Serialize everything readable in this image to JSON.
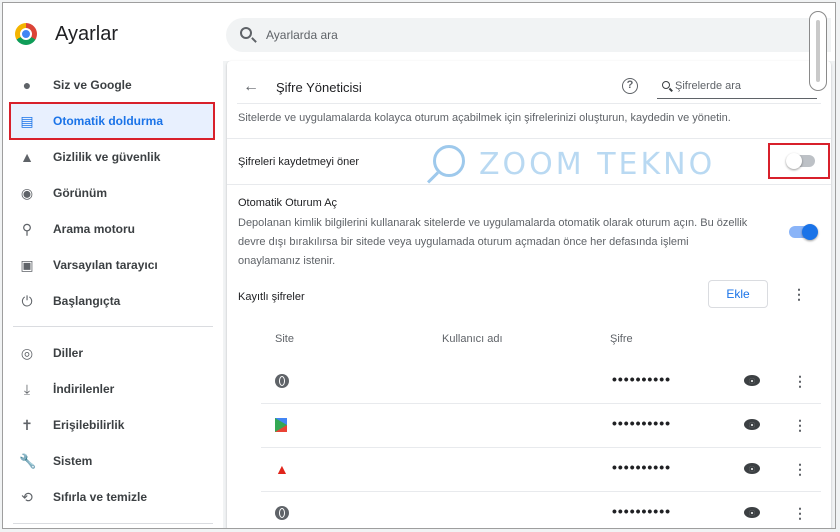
{
  "header": {
    "title": "Ayarlar",
    "search_placeholder": "Ayarlarda ara"
  },
  "sidebar": {
    "items": [
      {
        "label": "Siz ve Google",
        "icon": "person-icon"
      },
      {
        "label": "Otomatik doldurma",
        "icon": "clipboard-icon",
        "active": true
      },
      {
        "label": "Gizlilik ve güvenlik",
        "icon": "shield-icon"
      },
      {
        "label": "Görünüm",
        "icon": "palette-icon"
      },
      {
        "label": "Arama motoru",
        "icon": "search-icon"
      },
      {
        "label": "Varsayılan tarayıcı",
        "icon": "browser-icon"
      },
      {
        "label": "Başlangıçta",
        "icon": "power-icon"
      },
      {
        "label": "Diller",
        "icon": "globe-icon"
      },
      {
        "label": "İndirilenler",
        "icon": "download-icon"
      },
      {
        "label": "Erişilebilirlik",
        "icon": "accessibility-icon"
      },
      {
        "label": "Sistem",
        "icon": "wrench-icon"
      },
      {
        "label": "Sıfırla ve temizle",
        "icon": "restore-icon"
      }
    ]
  },
  "main": {
    "title": "Şifre Yöneticisi",
    "search_placeholder": "Şifrelerde ara",
    "description": "Sitelerde ve uygulamalarda kolayca oturum açabilmek için şifrelerinizi oluşturun, kaydedin ve yönetin.",
    "offer_to_save": {
      "label": "Şifreleri kaydetmeyi öner",
      "enabled": false
    },
    "auto_sign_in": {
      "title": "Otomatik Oturum Aç",
      "description": "Depolanan kimlik bilgilerini kullanarak sitelerde ve uygulamalarda otomatik olarak oturum açın. Bu özellik devre dışı bırakılırsa bir sitede veya uygulamada oturum açmadan önce her defasında işlemi onaylamanız istenir.",
      "enabled": true
    },
    "saved_passwords": {
      "title": "Kayıtlı şifreler",
      "add_label": "Ekle",
      "columns": [
        "Site",
        "Kullanıcı adı",
        "Şifre"
      ],
      "rows": [
        {
          "icon": "globe-icon",
          "site": "",
          "password": "••••••••••"
        },
        {
          "icon": "play-store-icon",
          "site": "",
          "password": "••••••••••"
        },
        {
          "icon": "adobe-icon",
          "site": "",
          "password": "••••••••••"
        },
        {
          "icon": "globe-icon",
          "site": "",
          "password": "••••••••••"
        }
      ]
    }
  },
  "watermark": {
    "text": "ZOOM TEKNO"
  },
  "colors": {
    "accent": "#1a73e8",
    "highlight_border": "#d8202b",
    "active_bg": "#e8f0fe"
  }
}
